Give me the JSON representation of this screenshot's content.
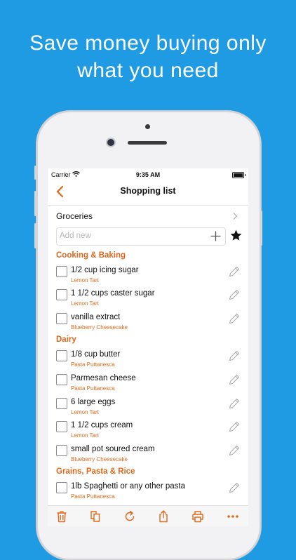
{
  "headline": {
    "line1": "Save money buying only",
    "line2": "what you need"
  },
  "status": {
    "carrier": "Carrier",
    "time": "9:35 AM"
  },
  "nav": {
    "title": "Shopping list"
  },
  "list": {
    "name": "Groceries"
  },
  "add": {
    "placeholder": "Add new"
  },
  "colors": {
    "accent": "#e0681b",
    "background": "#1e9be3"
  },
  "sections": [
    {
      "title": "Cooking & Baking",
      "items": [
        {
          "name": "1/2 cup icing sugar",
          "recipe": "Lemon Tart"
        },
        {
          "name": "1 1/2 cups caster sugar",
          "recipe": "Lemon Tart"
        },
        {
          "name": "vanilla extract",
          "recipe": "Blueberry Cheesecake"
        }
      ]
    },
    {
      "title": "Dairy",
      "items": [
        {
          "name": "1/8 cup butter",
          "recipe": "Pasta Puttanesca"
        },
        {
          "name": "Parmesan cheese",
          "recipe": "Pasta Puttanesca"
        },
        {
          "name": "6 large eggs",
          "recipe": "Lemon Tart"
        },
        {
          "name": "1 1/2 cups cream",
          "recipe": "Lemon Tart"
        },
        {
          "name": "small pot soured cream",
          "recipe": "Blueberry Cheesecake"
        }
      ]
    },
    {
      "title": "Grains, Pasta & Rice",
      "items": [
        {
          "name": "1lb Spaghetti or any other pasta",
          "recipe": "Pasta Puttanesca"
        }
      ]
    }
  ],
  "toolbar": [
    "trash-icon",
    "copy-icon",
    "refresh-icon",
    "share-icon",
    "print-icon",
    "more-icon"
  ]
}
